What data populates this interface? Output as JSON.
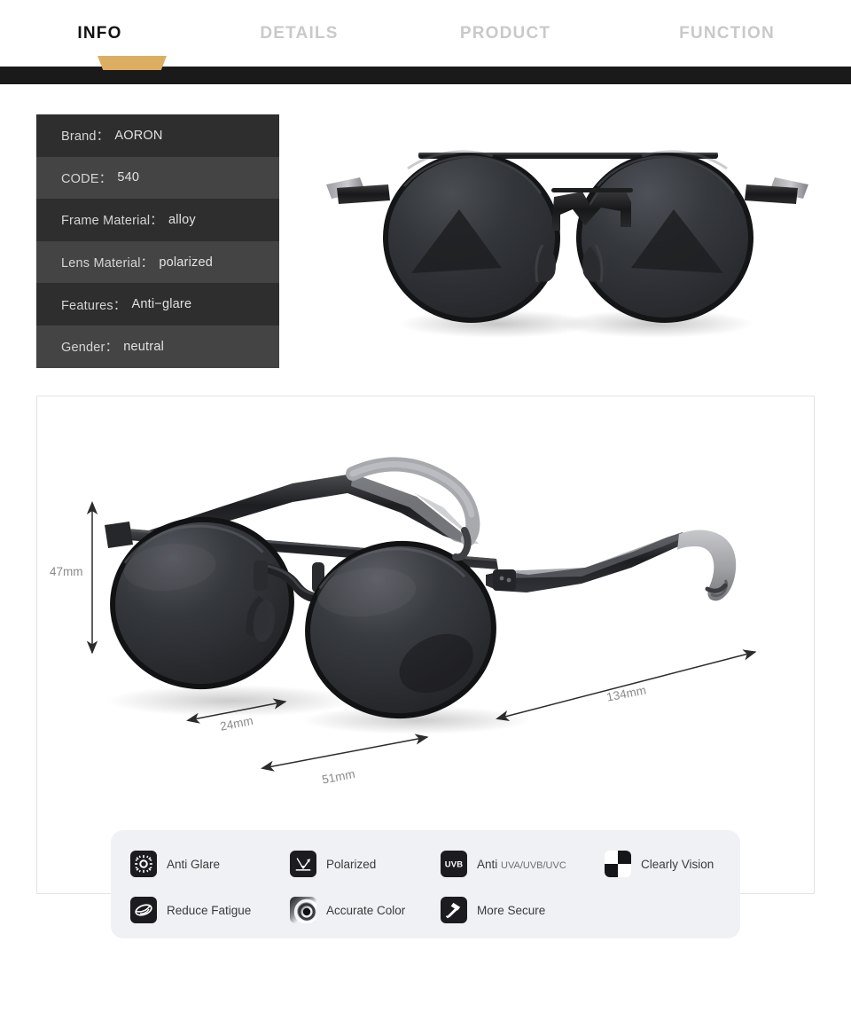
{
  "nav": {
    "tabs": [
      {
        "label": "INFO",
        "active": true
      },
      {
        "label": "DETAILS",
        "active": false
      },
      {
        "label": "PRODUCT",
        "active": false
      },
      {
        "label": "FUNCTION",
        "active": false
      }
    ],
    "accent_color": "#dcae62",
    "bar_color": "#1a1a1a"
  },
  "spec_table": {
    "rows": [
      {
        "label": "Brand：",
        "value": "AORON"
      },
      {
        "label": "CODE：",
        "value": "540"
      },
      {
        "label": "Frame Material：",
        "value": "alloy"
      },
      {
        "label": "Lens Material：",
        "value": "polarized"
      },
      {
        "label": "Features：",
        "value": "Anti−glare"
      },
      {
        "label": "Gender：",
        "value": "neutral"
      }
    ],
    "row_bg_odd": "#2e2e2e",
    "row_bg_even": "#444444"
  },
  "measurements": {
    "lens_height": "47mm",
    "bridge_width": "24mm",
    "lens_width": "51mm",
    "temple_length": "134mm"
  },
  "features": {
    "row1": [
      {
        "icon": "sun-glare-icon",
        "label": "Anti Glare",
        "sub": ""
      },
      {
        "icon": "polarized-arrows-icon",
        "label": "Polarized",
        "sub": ""
      },
      {
        "icon": "uvb-badge-icon",
        "label": "Anti ",
        "sub": "UVA/UVB/UVC"
      },
      {
        "icon": "checkerboard-icon",
        "label": "Clearly Vision",
        "sub": ""
      }
    ],
    "row2": [
      {
        "icon": "eye-icon",
        "label": "Reduce Fatigue",
        "sub": ""
      },
      {
        "icon": "color-ring-icon",
        "label": "Accurate Color",
        "sub": ""
      },
      {
        "icon": "hammer-icon",
        "label": "More Secure",
        "sub": ""
      }
    ]
  }
}
